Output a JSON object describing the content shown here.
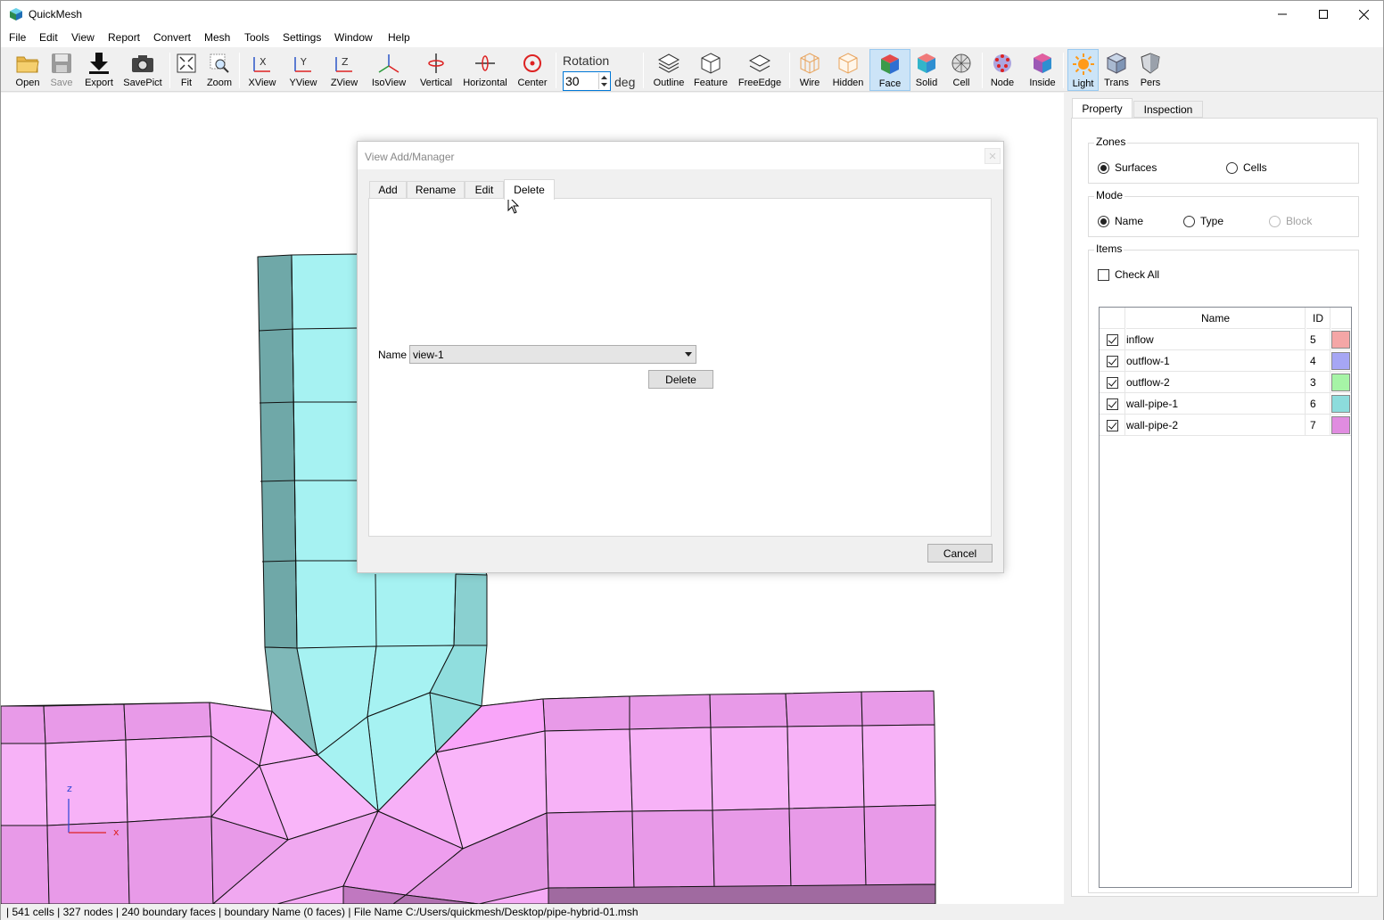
{
  "app": {
    "title": "QuickMesh",
    "accent": "#0078d7"
  },
  "menu": [
    "File",
    "Edit",
    "View",
    "Report",
    "Convert",
    "Mesh",
    "Tools",
    "Settings",
    "Window",
    "Help"
  ],
  "toolbar": {
    "open": "Open",
    "save": "Save",
    "export": "Export",
    "savepict": "SavePict",
    "fit": "Fit",
    "zoom": "Zoom",
    "xview": "XView",
    "yview": "YView",
    "zview": "ZView",
    "isoview": "IsoView",
    "vertical": "Vertical",
    "horizontal": "Horizontal",
    "center": "Center",
    "rotation_label": "Rotation",
    "rotation_value": "30",
    "rotation_unit": "deg",
    "outline": "Outline",
    "feature": "Feature",
    "freeedge": "FreeEdge",
    "wire": "Wire",
    "hidden": "Hidden",
    "face": "Face",
    "solid": "Solid",
    "cell": "Cell",
    "node": "Node",
    "inside": "Inside",
    "light": "Light",
    "trans": "Trans",
    "pers": "Pers"
  },
  "panel": {
    "tabs": [
      "Property",
      "Inspection"
    ],
    "zones": {
      "title": "Zones",
      "surfaces": "Surfaces",
      "cells": "Cells",
      "selected": "Surfaces"
    },
    "mode": {
      "title": "Mode",
      "name": "Name",
      "type": "Type",
      "block": "Block",
      "selected": "Name"
    },
    "items": {
      "title": "Items",
      "check_all": "Check All",
      "columns": {
        "name": "Name",
        "id": "ID"
      },
      "rows": [
        {
          "name": "inflow",
          "id": "5",
          "checked": true,
          "color": "#f4a6a6"
        },
        {
          "name": "outflow-1",
          "id": "4",
          "checked": true,
          "color": "#a6a6f4"
        },
        {
          "name": "outflow-2",
          "id": "3",
          "checked": true,
          "color": "#a6f4a6"
        },
        {
          "name": "wall-pipe-1",
          "id": "6",
          "checked": true,
          "color": "#8cdcdc"
        },
        {
          "name": "wall-pipe-2",
          "id": "7",
          "checked": true,
          "color": "#e08ce0"
        }
      ]
    }
  },
  "dialog": {
    "title": "View Add/Manager",
    "tabs": {
      "add": "Add",
      "rename": "Rename",
      "edit": "Edit",
      "delete": "Delete"
    },
    "name_label": "Name",
    "name_value": "view-1",
    "delete_button": "Delete",
    "cancel_button": "Cancel"
  },
  "axis": {
    "z": "z",
    "x": "x"
  },
  "status": "| 541 cells | 327 nodes | 240 boundary faces |  boundary Name  (0 faces) | File Name C:/Users/quickmesh/Desktop/pipe-hybrid-01.msh"
}
